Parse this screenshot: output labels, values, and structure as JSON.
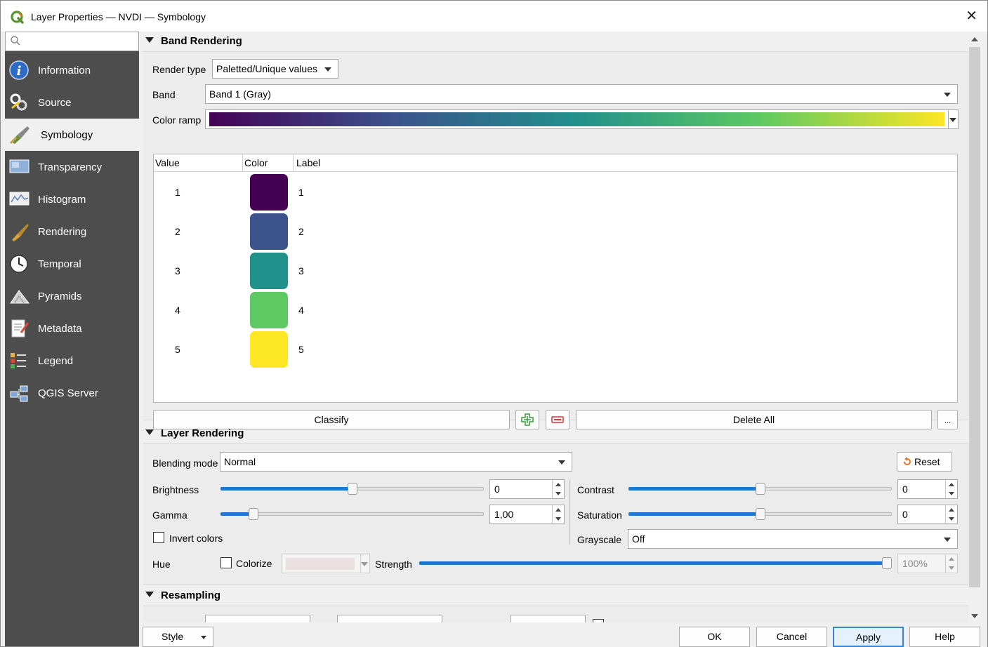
{
  "window": {
    "title": "Layer Properties — NVDI — Symbology",
    "close": "✕"
  },
  "sidebar": {
    "search_placeholder": "",
    "items": [
      {
        "label": "Information",
        "icon": "info-icon"
      },
      {
        "label": "Source",
        "icon": "source-icon"
      },
      {
        "label": "Symbology",
        "icon": "symbology-icon",
        "selected": true
      },
      {
        "label": "Transparency",
        "icon": "transparency-icon"
      },
      {
        "label": "Histogram",
        "icon": "histogram-icon"
      },
      {
        "label": "Rendering",
        "icon": "rendering-icon"
      },
      {
        "label": "Temporal",
        "icon": "temporal-icon"
      },
      {
        "label": "Pyramids",
        "icon": "pyramids-icon"
      },
      {
        "label": "Metadata",
        "icon": "metadata-icon"
      },
      {
        "label": "Legend",
        "icon": "legend-icon"
      },
      {
        "label": "QGIS Server",
        "icon": "qgis-server-icon"
      }
    ]
  },
  "band_rendering": {
    "title": "Band Rendering",
    "render_type_label": "Render type",
    "render_type_value": "Paletted/Unique values",
    "band_label": "Band",
    "band_value": "Band 1 (Gray)",
    "color_ramp_label": "Color ramp",
    "color_ramp_stops": [
      "#440154",
      "#3b528b",
      "#21918c",
      "#5ec962",
      "#fde725"
    ],
    "table_headers": {
      "value": "Value",
      "color": "Color",
      "label": "Label"
    },
    "classes": [
      {
        "value": "1",
        "color": "#440154",
        "label": "1"
      },
      {
        "value": "2",
        "color": "#3b528b",
        "label": "2"
      },
      {
        "value": "3",
        "color": "#21918c",
        "label": "3"
      },
      {
        "value": "4",
        "color": "#5ec962",
        "label": "4"
      },
      {
        "value": "5",
        "color": "#fde725",
        "label": "5"
      }
    ],
    "classify_label": "Classify",
    "delete_all_label": "Delete All",
    "more_label": "..."
  },
  "layer_rendering": {
    "title": "Layer Rendering",
    "blending_mode_label": "Blending mode",
    "blending_mode_value": "Normal",
    "reset_label": "Reset",
    "brightness_label": "Brightness",
    "brightness_value": "0",
    "brightness_level": 0.5,
    "contrast_label": "Contrast",
    "contrast_value": "0",
    "contrast_level": 0.5,
    "gamma_label": "Gamma",
    "gamma_value": "1,00",
    "gamma_level": 0.11,
    "saturation_label": "Saturation",
    "saturation_value": "0",
    "saturation_level": 0.5,
    "invert_colors_label": "Invert colors",
    "grayscale_label": "Grayscale",
    "grayscale_value": "Off",
    "hue_label": "Hue",
    "colorize_label": "Colorize",
    "strength_label": "Strength",
    "strength_value": "100%",
    "strength_level": 1.0
  },
  "resampling": {
    "title": "Resampling"
  },
  "footer": {
    "style_label": "Style",
    "ok_label": "OK",
    "cancel_label": "Cancel",
    "apply_label": "Apply",
    "help_label": "Help"
  }
}
